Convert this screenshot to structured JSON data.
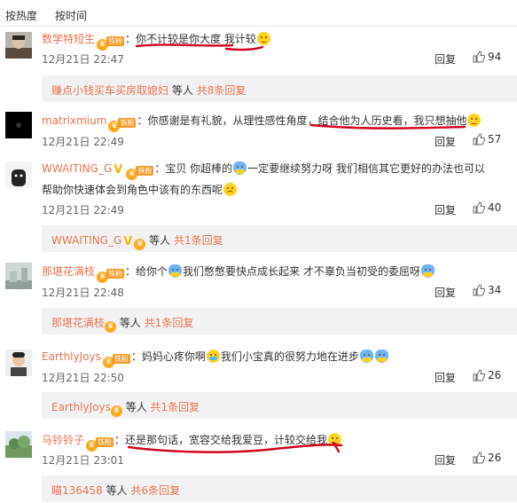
{
  "tabs": {
    "hot": "按热度",
    "time": "按时间"
  },
  "icons": {
    "like": "thumbs-up-icon",
    "vip": "vip-crown-icon",
    "fan_badge": "fan-badge-icon",
    "verified": "verified-v-icon"
  },
  "colors": {
    "username": "#eb7350",
    "subreply_bg": "#f2f2f5",
    "badge": "#f59b26",
    "underline": "#d0021b"
  },
  "badge_label": "铁粉",
  "reply_label": "回复",
  "comments": [
    {
      "user": "数学特短生",
      "text": "：你不计较是你大度 我计较",
      "time": "12月21日 22:47",
      "likes": "94",
      "sub": {
        "user": "赚点小钱买车买房取媳妇",
        "mid": "等人",
        "count": "共8条回复"
      }
    },
    {
      "user": "matrixmium",
      "text": "：你感谢是有礼貌，从理性感性角度，结合他为人历史看，我只想抽他",
      "time": "12月21日 22:49",
      "likes": "57",
      "sub": null
    },
    {
      "user": "WWAITING_G",
      "text": "：宝贝 你超棒的",
      "text2": "一定要继续努力呀 我们相信其它更好的办法也可以",
      "text3": "帮助你快速体会到角色中该有的东西呢",
      "time": "12月21日 22:49",
      "likes": "40",
      "sub": {
        "user": "WWAITING_G",
        "mid": "等人",
        "count": "共1条回复"
      }
    },
    {
      "user": "那堪花满枝",
      "text": "：给你个",
      "text2": "我们憋憋要快点成长起来 才不辜负当初受的委屈呀",
      "time": "12月21日 22:48",
      "likes": "34",
      "sub": {
        "user": "那堪花满枝",
        "mid": "等人",
        "count": "共1条回复"
      }
    },
    {
      "user": "EarthlyJoys",
      "text": "：妈妈心疼你啊",
      "text2": "我们小宝真的很努力地在进步",
      "time": "12月21日 22:50",
      "likes": "26",
      "sub": {
        "user": "EarthlyJoys",
        "mid": "等人",
        "count": "共1条回复"
      }
    },
    {
      "user": "马铃铃子",
      "text": "：还是那句话，宽容交给我爱豆，计较交给我",
      "time": "12月21日 23:01",
      "likes": "26",
      "sub": {
        "user": "瞄136458",
        "mid": "等人",
        "count": "共6条回复"
      }
    }
  ]
}
